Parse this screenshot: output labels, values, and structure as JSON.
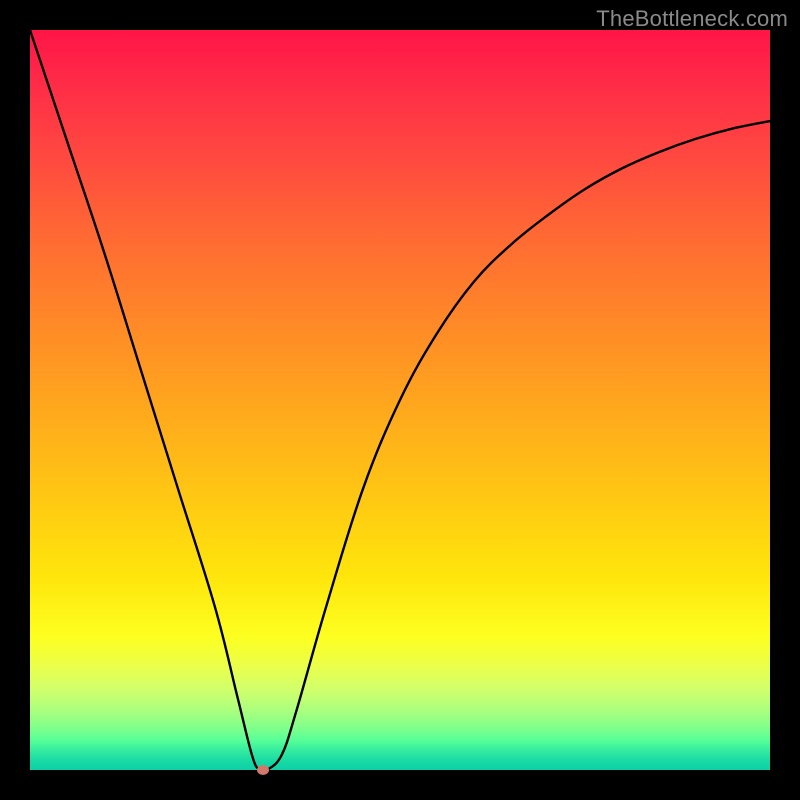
{
  "watermark": "TheBottleneck.com",
  "marker_color": "#d4776b",
  "curve_stroke": "#000000",
  "chart_data": {
    "type": "line",
    "title": "",
    "xlabel": "",
    "ylabel": "",
    "xlim": [
      0,
      100
    ],
    "ylim": [
      0,
      100
    ],
    "grid": false,
    "description": "Bottleneck-style V-curve with a sharp minimum near x≈31 and an asymptotic rise to the right. Y is shown inverted (higher = worse, plotted toward top).",
    "series": [
      {
        "name": "bottleneck-curve",
        "x": [
          0,
          5,
          10,
          15,
          20,
          25,
          28,
          30,
          31,
          32,
          34,
          36,
          40,
          45,
          50,
          55,
          60,
          65,
          70,
          75,
          80,
          85,
          90,
          95,
          100
        ],
        "y": [
          100,
          85,
          70,
          54,
          38,
          22,
          10,
          2,
          0,
          0,
          2,
          8,
          22,
          38,
          50,
          59,
          66,
          71,
          75,
          78.5,
          81.3,
          83.5,
          85.3,
          86.7,
          87.7
        ]
      }
    ],
    "marker": {
      "x": 31.5,
      "y": 0
    }
  }
}
